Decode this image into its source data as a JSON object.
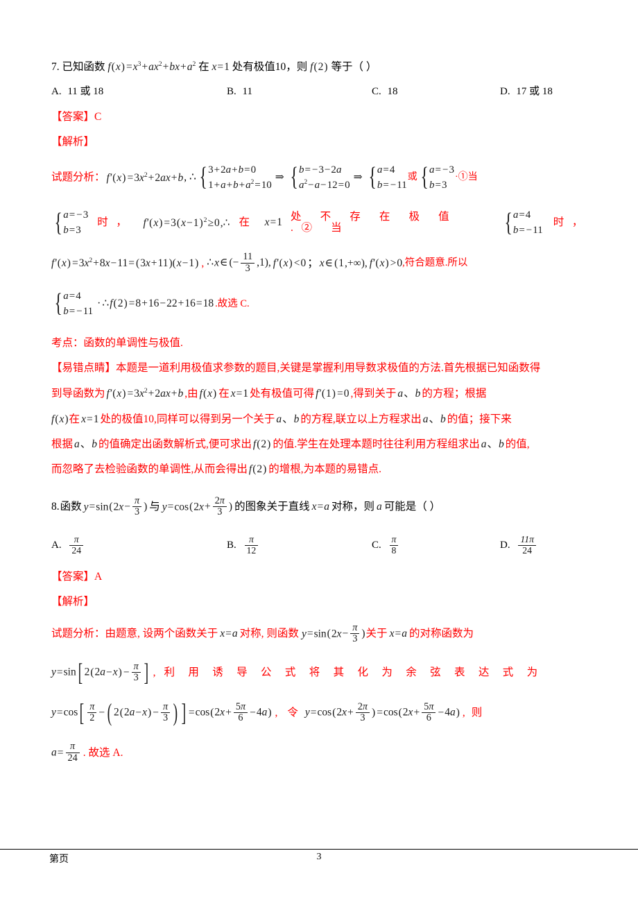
{
  "document": {
    "page_number": "3",
    "footer_left": "第页",
    "colors": {
      "answer_red": "#ff0000",
      "math_black": "#1a1a1a",
      "body_black": "#000000"
    }
  },
  "q7": {
    "number": "7.",
    "stem_prefix": "已知函数",
    "stem_f": "f (x) = x³ + ax² + bx + a²",
    "stem_mid": "在",
    "stem_x": "x = 1",
    "stem_tail": "处有极值10，则",
    "stem_f2": "f (2)",
    "stem_end": "等于（    ）",
    "options": [
      {
        "label": "A.",
        "value": "11 或 18"
      },
      {
        "label": "B.",
        "value": "11"
      },
      {
        "label": "C.",
        "value": "18"
      },
      {
        "label": "D.",
        "value": "17 或 18"
      }
    ],
    "answer_label": "【答案】",
    "answer_value": "C",
    "analysis_label": "【解析】",
    "analysis_prefix": "试题分析：",
    "deriv": "f ′(x) = 3x² + 2ax + b",
    "therefore": ", ∴",
    "system1": [
      "3 + 2a + b = 0",
      "1 + a + b + a² = 10"
    ],
    "arrow1": "⇒",
    "system2": [
      "b = −3 − 2a",
      "a² − a − 12 = 0"
    ],
    "arrow2": "⇒",
    "system3": [
      "a = 4",
      "b = −11"
    ],
    "or_word": "或",
    "system4": [
      "a = −3",
      "b = 3"
    ],
    "note1": "·①当",
    "case1_system": [
      "a = −3",
      "b = 3"
    ],
    "case1_when": "时，",
    "case1_math": "f ′(x) = 3(x − 1)² ≥ 0,∴",
    "case1_text_a": "在",
    "case1_x": "x = 1",
    "case1_text_b": "处 不 存 在 极 值 .② 当",
    "case2_system": [
      "a = 4",
      "b = −11"
    ],
    "case2_when": "时，",
    "line_deriv2": "f ′(x) = 3x² + 8x − 11 = (3x + 11)(x − 1)",
    "comma1": ",",
    "interval1_pre": "∴ x ∈ (−",
    "interval1_frac_num": "11",
    "interval1_frac_den": "3",
    "interval1_post": ",1),",
    "ineq1": "f ′(x) < 0",
    "semi": "；",
    "interval2": "x ∈ (1,+∞),",
    "ineq2": "f ′(x) > 0",
    "conclusion_red1": ",符合题意.所以",
    "final_system": [
      "a = 4",
      "b = −11"
    ],
    "final_math": "∴ f (2) = 8 + 16 − 22 + 16 = 18",
    "final_red": ".故选 C.",
    "kaodian": "考点：函数的单调性与极值.",
    "tip_label": "【易错点睛】",
    "tip_p1_a": "本题是一道利用极值求参数的题目,关键是掌握利用导数求极值的方法.首先根据已知函数得",
    "tip_p2_a": "到导函数为",
    "tip_p2_math1": "f ′(x) = 3x² + 2ax + b",
    "tip_p2_b": ",由",
    "tip_p2_math2": "f (x)",
    "tip_p2_c": "在",
    "tip_p2_math3": "x = 1",
    "tip_p2_d": "处有极值可得",
    "tip_p2_math4": "f ′(1) = 0",
    "tip_p2_e": ",得到关于",
    "tip_p2_math5": "a、b",
    "tip_p2_f": "的方程；根据",
    "tip_p3_math1": "f (x)",
    "tip_p3_a": "在",
    "tip_p3_math2": "x = 1",
    "tip_p3_b": "处的极值10,同样可以得到另一个关于",
    "tip_p3_math3": "a、b",
    "tip_p3_c": "的方程,联立以上方程求出",
    "tip_p3_math4": "a、b",
    "tip_p3_d": "的值；接下来",
    "tip_p4_a": "根据",
    "tip_p4_math1": "a、b",
    "tip_p4_b": "的值确定出函数解析式,便可求出",
    "tip_p4_math2": "f (2)",
    "tip_p4_c": "的值.学生在处理本题时往往利用方程组求出",
    "tip_p4_math3": "a、b",
    "tip_p4_d": "的值,",
    "tip_p5_a": "而忽略了去检验函数的单调性,从而会得出",
    "tip_p5_math1": "f (2)",
    "tip_p5_b": "的增根,为本题的易错点."
  },
  "q8": {
    "number": "8.",
    "stem_prefix": "函数",
    "stem_m1_pre": "y = sin(2x −",
    "stem_m1_num": "π",
    "stem_m1_den": "3",
    "stem_m1_post": ")",
    "stem_mid": "与",
    "stem_m2_pre": "y = cos(2x +",
    "stem_m2_num": "2π",
    "stem_m2_den": "3",
    "stem_m2_post": ")",
    "stem_tail1": "的图象关于直线",
    "stem_m3": "x = a",
    "stem_tail2": "对称，则",
    "stem_m4": "a",
    "stem_tail3": "可能是（    ）",
    "options": [
      {
        "label": "A.",
        "num": "π",
        "den": "24"
      },
      {
        "label": "B.",
        "num": "π",
        "den": "12"
      },
      {
        "label": "C.",
        "num": "π",
        "den": "8"
      },
      {
        "label": "D.",
        "num": "11π",
        "den": "24"
      }
    ],
    "answer_label": "【答案】",
    "answer_value": "A",
    "analysis_label": "【解析】",
    "analysis_prefix": "试题分析：",
    "l1_a": "由题意, 设两个函数关于",
    "l1_m1": "x = a",
    "l1_b": "对称, 则函数",
    "l1_m2_pre": "y = sin(2x −",
    "l1_m2_num": "π",
    "l1_m2_den": "3",
    "l1_m2_post": ")",
    "l1_c": "关于",
    "l1_m3": "x = a",
    "l1_d": "的对称函数为",
    "l2_m_pre": "y = sin",
    "l2_m_inner": "2(2a − x) −",
    "l2_m_num": "π",
    "l2_m_den": "3",
    "l2_comma": ",",
    "l2_text": "利用诱导公式将其化为余弦表达式为",
    "l3_m1_pre": "y = cos",
    "l3_m1_f1n": "π",
    "l3_m1_f1d": "2",
    "l3_m1_mid": "− (2(2a − x) −",
    "l3_m1_f2n": "π",
    "l3_m1_f2d": "3",
    "l3_m1_close": ")",
    "l3_m1_eq_pre": "= cos(2x +",
    "l3_m1_f3n": "5π",
    "l3_m1_f3d": "6",
    "l3_m1_eq_post": "− 4a)",
    "l3_comma": ",",
    "l3_ling": "令",
    "l3_m2_pre": "y = cos(2x +",
    "l3_m2_f1n": "2π",
    "l3_m2_f1d": "3",
    "l3_m2_mid": ") = cos(2x +",
    "l3_m2_f2n": "5π",
    "l3_m2_f2d": "6",
    "l3_m2_post": "− 4a)",
    "l3_tail_comma": ",",
    "l3_ze": "则",
    "l4_m_pre": "a =",
    "l4_m_num": "π",
    "l4_m_den": "24",
    "l4_red": ". 故选 A."
  }
}
